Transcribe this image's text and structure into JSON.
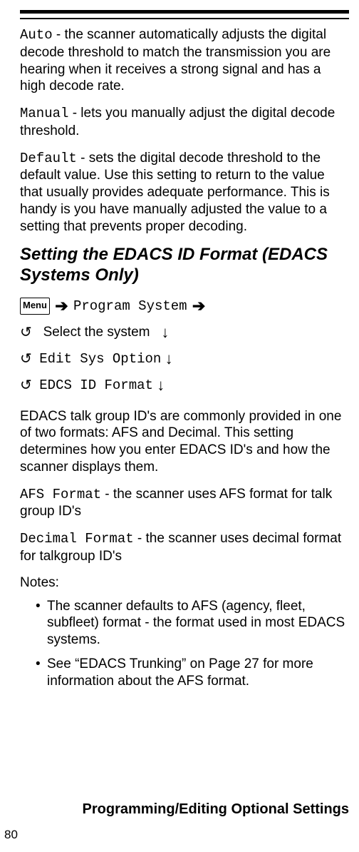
{
  "para1": {
    "lead": "Auto",
    "rest": " - the scanner automatically adjusts the digital decode threshold to match the transmission you are hearing when it receives a strong signal and has a high decode rate."
  },
  "para2": {
    "lead": "Manual",
    "rest": " - lets you manually adjust the digital decode threshold."
  },
  "para3": {
    "lead": "Default",
    "rest": " - sets the digital decode threshold to the default value. Use this setting to return to the value that usually provides adequate performance. This is handy is you have manually adjusted the value to a setting that prevents proper decoding."
  },
  "heading": "Setting the EDACS ID Format (EDACS Systems Only)",
  "menu": {
    "button": "Menu",
    "line1": "Program System",
    "line2": "Select the system",
    "line3": "Edit Sys Option",
    "line4": "EDCS ID Format"
  },
  "para4": "EDACS talk group ID's are commonly provided in one of two formats: AFS and Decimal. This setting determines how you enter EDACS ID's and how the scanner displays them.",
  "para5": {
    "lead": "AFS Format",
    "rest": " - the scanner uses AFS format for talk group ID's"
  },
  "para6": {
    "lead": "Decimal Format",
    "rest": " - the scanner uses decimal format for talkgroup ID's"
  },
  "notesLabel": "Notes:",
  "bullets": [
    "The scanner defaults to AFS (agency, fleet, subfleet) format - the format used in most EDACS systems.",
    "See “EDACS Trunking” on Page 27 for more information about the AFS format."
  ],
  "footer": "Programming/Editing Optional Settings",
  "pageNumber": "80"
}
